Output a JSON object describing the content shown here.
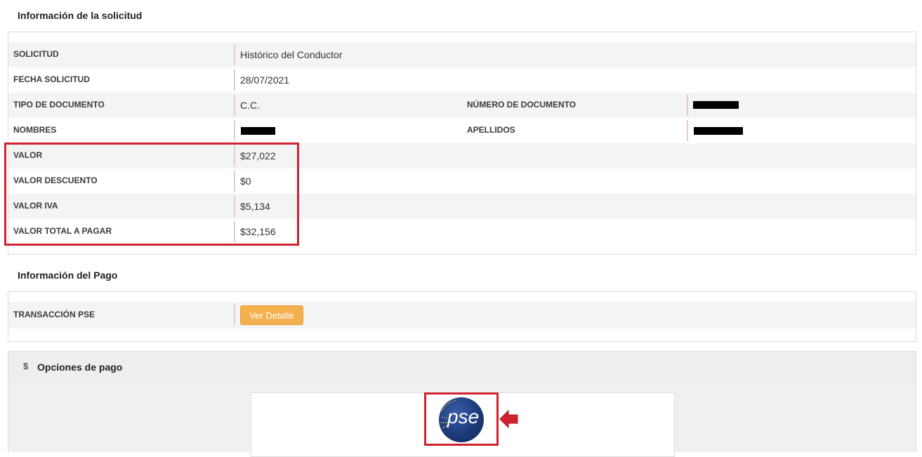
{
  "solicitud_section": {
    "title": "Información de la solicitud",
    "rows": [
      {
        "label": "SOLICITUD",
        "value": "Histórico del Conductor"
      },
      {
        "label": "FECHA SOLICITUD",
        "value": "28/07/2021"
      },
      {
        "label": "TIPO DE DOCUMENTO",
        "value": "C.C.",
        "label2": "NÚMERO DE DOCUMENTO"
      },
      {
        "label": "NOMBRES",
        "label2": "APELLIDOS"
      },
      {
        "label": "VALOR",
        "value": "$27,022"
      },
      {
        "label": "VALOR DESCUENTO",
        "value": "$0"
      },
      {
        "label": "VALOR IVA",
        "value": "$5,134"
      },
      {
        "label": "VALOR TOTAL A PAGAR",
        "value": "$32,156"
      }
    ]
  },
  "pago_section": {
    "title": "Información del Pago",
    "transaccion_label": "TRANSACCIÓN PSE",
    "ver_detalle_button": "Ver Detalle"
  },
  "opciones_pago": {
    "icon": "dollar-icon",
    "icon_glyph": "$",
    "title": "Opciones de pago",
    "pse_logo_text": "pse"
  },
  "colors": {
    "highlight": "#d0222f",
    "button": "#f5b04e"
  }
}
